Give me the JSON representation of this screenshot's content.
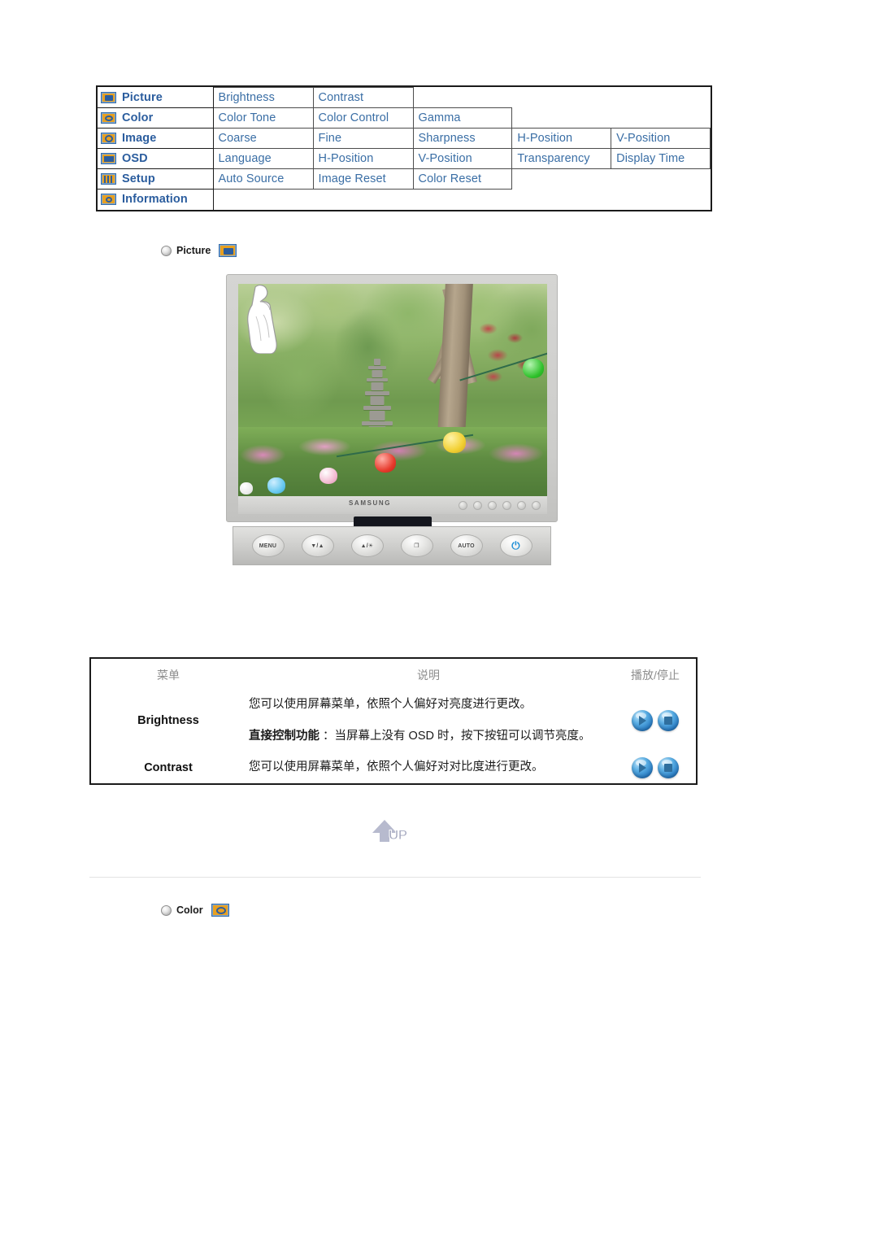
{
  "osd_menu": {
    "rows": [
      {
        "icon": "picture-icon",
        "category": "Picture",
        "items": [
          "Brightness",
          "Contrast"
        ]
      },
      {
        "icon": "color-icon",
        "category": "Color",
        "items": [
          "Color Tone",
          "Color Control",
          "Gamma"
        ]
      },
      {
        "icon": "image-icon",
        "category": "Image",
        "items": [
          "Coarse",
          "Fine",
          "Sharpness",
          "H-Position",
          "V-Position"
        ]
      },
      {
        "icon": "osd-icon",
        "category": "OSD",
        "items": [
          "Language",
          "H-Position",
          "V-Position",
          "Transparency",
          "Display Time"
        ]
      },
      {
        "icon": "setup-icon",
        "category": "Setup",
        "items": [
          "Auto Source",
          "Image Reset",
          "Color Reset"
        ]
      },
      {
        "icon": "information-icon",
        "category": "Information",
        "items": []
      }
    ],
    "text_color": "#3a6ea5",
    "icon_color": "#e8a020"
  },
  "sections": {
    "picture": {
      "label": "Picture",
      "bullet": "sphere-bullet",
      "icon": "picture-icon"
    },
    "color": {
      "label": "Color",
      "bullet": "sphere-bullet",
      "icon": "color-icon"
    }
  },
  "monitor": {
    "brand": "SAMSUNG",
    "panel_buttons": [
      "MENU",
      "▼/▲",
      "▲/☀",
      "❐",
      "AUTO",
      "⏻"
    ],
    "power_button_color": "#1f8fd6",
    "screen_scene": "korean-garden-with-pagodas-and-lanterns"
  },
  "description_table": {
    "headers": [
      "菜单",
      "说明",
      "播放/停止"
    ],
    "rows": [
      {
        "menu": "Brightness",
        "lines": [
          {
            "bold": "",
            "text": "您可以使用屏幕菜单，依照个人偏好对亮度进行更改。"
          },
          {
            "bold": "直接控制功能",
            "text": " ：当屏幕上没有 OSD 时，按下按钮可以调节亮度。"
          }
        ],
        "buttons": [
          "play",
          "stop"
        ]
      },
      {
        "menu": "Contrast",
        "lines": [
          {
            "bold": "",
            "text": "您可以使用屏幕菜单，依照个人偏好对对比度进行更改。"
          }
        ],
        "buttons": [
          "play",
          "stop"
        ]
      }
    ]
  },
  "up_button": {
    "label": "UP",
    "color": "#b7bace"
  }
}
